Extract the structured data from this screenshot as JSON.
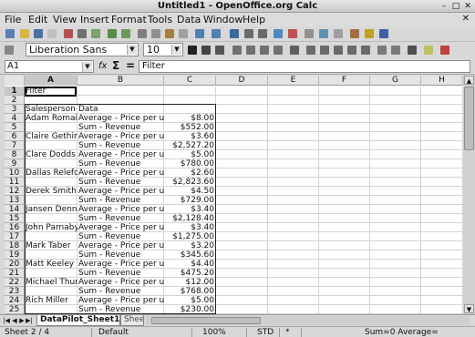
{
  "window": {
    "title": "Untitled1 - OpenOffice.org Calc",
    "min_glyph": "–",
    "max_glyph": "□",
    "close_glyph": "✕"
  },
  "menu": {
    "items": [
      {
        "label": "File"
      },
      {
        "label": "Edit"
      },
      {
        "label": "View"
      },
      {
        "label": "Insert"
      },
      {
        "label": "Format"
      },
      {
        "label": "Tools"
      },
      {
        "label": "Data"
      },
      {
        "label": "Window"
      },
      {
        "label": "Help"
      }
    ],
    "close_glyph": "✕"
  },
  "formatting": {
    "font_name": "Liberation Sans",
    "font_size": "10",
    "dropdown_glyph": "▼"
  },
  "formula_bar": {
    "cell_ref": "A1",
    "fx_label": "fx",
    "sigma_label": "Σ",
    "equals_label": "=",
    "content": "Filter"
  },
  "sheet": {
    "columns": [
      "A",
      "B",
      "C",
      "D",
      "E",
      "F",
      "G",
      "H"
    ],
    "selected_column": "A",
    "rows": [
      "1",
      "2",
      "3",
      "4",
      "5",
      "6",
      "7",
      "8",
      "9",
      "10",
      "11",
      "12",
      "13",
      "14",
      "15",
      "16",
      "17",
      "18",
      "19",
      "20",
      "21",
      "22",
      "23",
      "24",
      "25"
    ],
    "selected_row": "1",
    "cells": [
      [
        "Filter",
        "",
        ""
      ],
      [
        "",
        "",
        ""
      ],
      [
        "Salesperson",
        "Data",
        ""
      ],
      [
        "Adam Romain",
        "Average - Price per unit",
        "$8.00"
      ],
      [
        "",
        "Sum - Revenue",
        "$552.00"
      ],
      [
        "Claire Gethin",
        "Average - Price per unit",
        "$3.60"
      ],
      [
        "",
        "Sum - Revenue",
        "$2,527.20"
      ],
      [
        "Clare Dodds",
        "Average - Price per unit",
        "$5.00"
      ],
      [
        "",
        "Sum - Revenue",
        "$780.00"
      ],
      [
        "Dallas Relefor",
        "Average - Price per unit",
        "$2.60"
      ],
      [
        "",
        "Sum - Revenue",
        "$2,823.60"
      ],
      [
        "Derek Smith",
        "Average - Price per unit",
        "$4.50"
      ],
      [
        "",
        "Sum - Revenue",
        "$729.00"
      ],
      [
        "Jansen Denne",
        "Average - Price per unit",
        "$3.40"
      ],
      [
        "",
        "Sum - Revenue",
        "$2,128.40"
      ],
      [
        "John Parnaby",
        "Average - Price per unit",
        "$3.40"
      ],
      [
        "",
        "Sum - Revenue",
        "$1,275.00"
      ],
      [
        "Mark Taber",
        "Average - Price per unit",
        "$3.20"
      ],
      [
        "",
        "Sum - Revenue",
        "$345.60"
      ],
      [
        "Matt Keeley",
        "Average - Price per unit",
        "$4.40"
      ],
      [
        "",
        "Sum - Revenue",
        "$475.20"
      ],
      [
        "Michael Thurs",
        "Average - Price per unit",
        "$12.00"
      ],
      [
        "",
        "Sum - Revenue",
        "$768.00"
      ],
      [
        "Rich Miller",
        "Average - Price per unit",
        "$5.00"
      ],
      [
        "",
        "Sum - Revenue",
        "$230.00"
      ]
    ]
  },
  "tabs": {
    "nav": [
      "|◀",
      "◀",
      "▶",
      "▶|"
    ],
    "active": "DataPilot_Sheet1_1",
    "inactive": "Shee"
  },
  "status": {
    "sheet": "Sheet 2 / 4",
    "style": "Default",
    "zoom": "100%",
    "mode": "STD",
    "modified": "*",
    "summary": "Sum=0 Average="
  }
}
